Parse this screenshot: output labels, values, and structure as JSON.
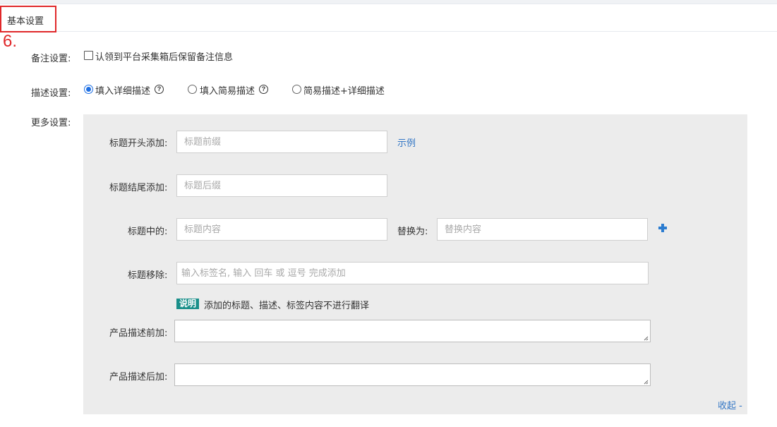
{
  "header": {
    "section_title": "基本设置",
    "step_number": "6."
  },
  "remark": {
    "label": "备注设置:",
    "checkbox_label": "认领到平台采集箱后保留备注信息",
    "checked": false
  },
  "description": {
    "label": "描述设置:",
    "options": [
      {
        "label": "填入详细描述",
        "selected": true,
        "has_help": true
      },
      {
        "label": "填入简易描述",
        "selected": false,
        "has_help": true
      },
      {
        "label": "简易描述+详细描述",
        "selected": false,
        "has_help": false
      }
    ],
    "help_glyph": "?"
  },
  "more": {
    "label": "更多设置:",
    "title_prefix": {
      "label": "标题开头添加:",
      "placeholder": "标题前缀",
      "example_link": "示例"
    },
    "title_suffix": {
      "label": "标题结尾添加:",
      "placeholder": "标题后缀"
    },
    "title_replace": {
      "label": "标题中的:",
      "placeholder": "标题内容",
      "replace_label": "替换为:",
      "replace_placeholder": "替换内容"
    },
    "title_remove": {
      "label": "标题移除:",
      "placeholder": "输入标签名, 输入 回车 或 逗号 完成添加"
    },
    "note": {
      "badge": "说明",
      "text": "添加的标题、描述、标签内容不进行翻译"
    },
    "desc_before": {
      "label": "产品描述前加:"
    },
    "desc_after": {
      "label": "产品描述后加:"
    },
    "collapse_link": "收起 -"
  },
  "colors": {
    "highlight_border": "#e0282a",
    "link": "#3477c5",
    "radio_selected": "#1e6fe3",
    "note_badge": "#1a8f8a",
    "panel_background": "#ececec"
  },
  "icons": [
    "help-icon",
    "plus-icon"
  ]
}
